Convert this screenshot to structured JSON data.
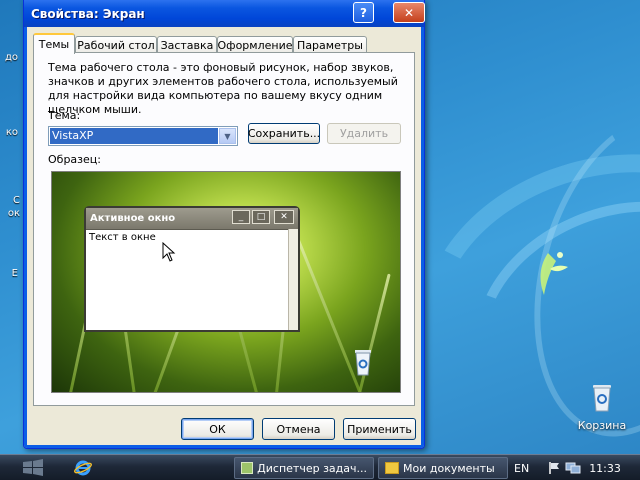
{
  "window": {
    "title": "Свойства: Экран",
    "help": "?",
    "close": "✕"
  },
  "tabs": [
    {
      "label": "Темы",
      "active": true
    },
    {
      "label": "Рабочий стол"
    },
    {
      "label": "Заставка"
    },
    {
      "label": "Оформление"
    },
    {
      "label": "Параметры"
    }
  ],
  "themes": {
    "description": "Тема рабочего стола - это фоновый рисунок, набор звуков, значков и других элементов рабочего стола, используемый для настройки вида компьютера по вашему вкусу одним щелчком мыши.",
    "theme_label": "Тема:",
    "theme_value": "VistaXP",
    "save_label": "Сохранить...",
    "delete_label": "Удалить",
    "sample_label": "Образец:"
  },
  "preview": {
    "window_title": "Активное окно",
    "window_text": "Текст в окне"
  },
  "footer": {
    "ok": "ОК",
    "cancel": "Отмена",
    "apply": "Применить"
  },
  "desktop": {
    "recycle_bin": "Корзина",
    "left_marks": [
      "до",
      "ко",
      "С ок",
      "Е"
    ]
  },
  "taskbar": {
    "items": [
      {
        "label": "Диспетчер задач..."
      },
      {
        "label": "Мои документы"
      }
    ],
    "lang": "EN",
    "clock": "11:33"
  },
  "colors": {
    "accent": "#0a56e0",
    "selection": "#316ac5",
    "taskbar": "#1e2838"
  }
}
